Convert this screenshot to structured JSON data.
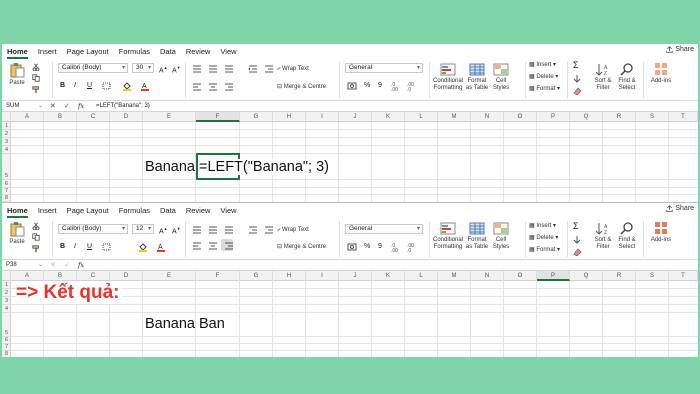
{
  "tabs": [
    "Home",
    "Insert",
    "Page Layout",
    "Formulas",
    "Data",
    "Review",
    "View"
  ],
  "share_label": "Share",
  "ribbon_top": {
    "font_name": "Calibri (Body)",
    "font_size": "30",
    "number_format": "General"
  },
  "ribbon_bottom": {
    "font_name": "Calibri (Body)",
    "font_size": "12",
    "number_format": "General"
  },
  "ribbon": {
    "paste": "Paste",
    "wrap_text": "Wrap Text",
    "merge_centre": "Merge & Centre",
    "bold": "B",
    "italic": "I",
    "underline": "U",
    "percent": "%",
    "comma": "9",
    "conditional_1": "Conditional",
    "conditional_2": "Formatting",
    "format_table_1": "Format",
    "format_table_2": "as Table",
    "cell_styles_1": "Cell",
    "cell_styles_2": "Styles",
    "insert": "Insert",
    "delete": "Delete",
    "format": "Format",
    "sort_1": "Sort &",
    "sort_2": "Filter",
    "find_1": "Find &",
    "find_2": "Select",
    "addins": "Add-ins"
  },
  "formula_top": {
    "name_box": "SUM",
    "formula": "=LEFT(\"Banana\"; 3)"
  },
  "formula_bottom": {
    "name_box": "P38",
    "formula": ""
  },
  "columns": [
    "A",
    "B",
    "C",
    "D",
    "E",
    "F",
    "G",
    "H",
    "I",
    "J",
    "K",
    "L",
    "M",
    "N",
    "O",
    "P",
    "Q",
    "R",
    "S",
    "T"
  ],
  "rows_top": [
    "1",
    "2",
    "3",
    "4",
    "5",
    "6",
    "7",
    "8"
  ],
  "rows_bottom": [
    "1",
    "2",
    "3",
    "4",
    "5",
    "6",
    "7",
    "8"
  ],
  "sheet_top": {
    "cell_e5": "Banana",
    "cell_f5": "=LEFT(\"Banana\"; 3)"
  },
  "sheet_bottom": {
    "result_label": "=> Kết quả:",
    "cell_e5": "Banana",
    "cell_f5": "Ban"
  },
  "colors": {
    "accent": "#1f7244",
    "result_red": "#e8322c",
    "background": "#7fd5a8"
  }
}
